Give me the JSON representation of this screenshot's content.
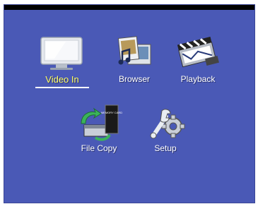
{
  "menu": {
    "items": [
      {
        "label": "Video In",
        "icon": "tv-monitor-icon",
        "selected": true
      },
      {
        "label": "Browser",
        "icon": "media-browser-icon",
        "selected": false
      },
      {
        "label": "Playback",
        "icon": "film-clapper-icon",
        "selected": false
      },
      {
        "label": "File Copy",
        "icon": "file-copy-icon",
        "selected": false
      },
      {
        "label": "Setup",
        "icon": "wrench-gear-icon",
        "selected": false
      }
    ],
    "icon_text": {
      "memory_card": "MEMORY CARD"
    }
  },
  "colors": {
    "background": "#4a59b6",
    "label": "#ffffff",
    "selected_label": "#ffff66",
    "top_bar": "#000000"
  }
}
